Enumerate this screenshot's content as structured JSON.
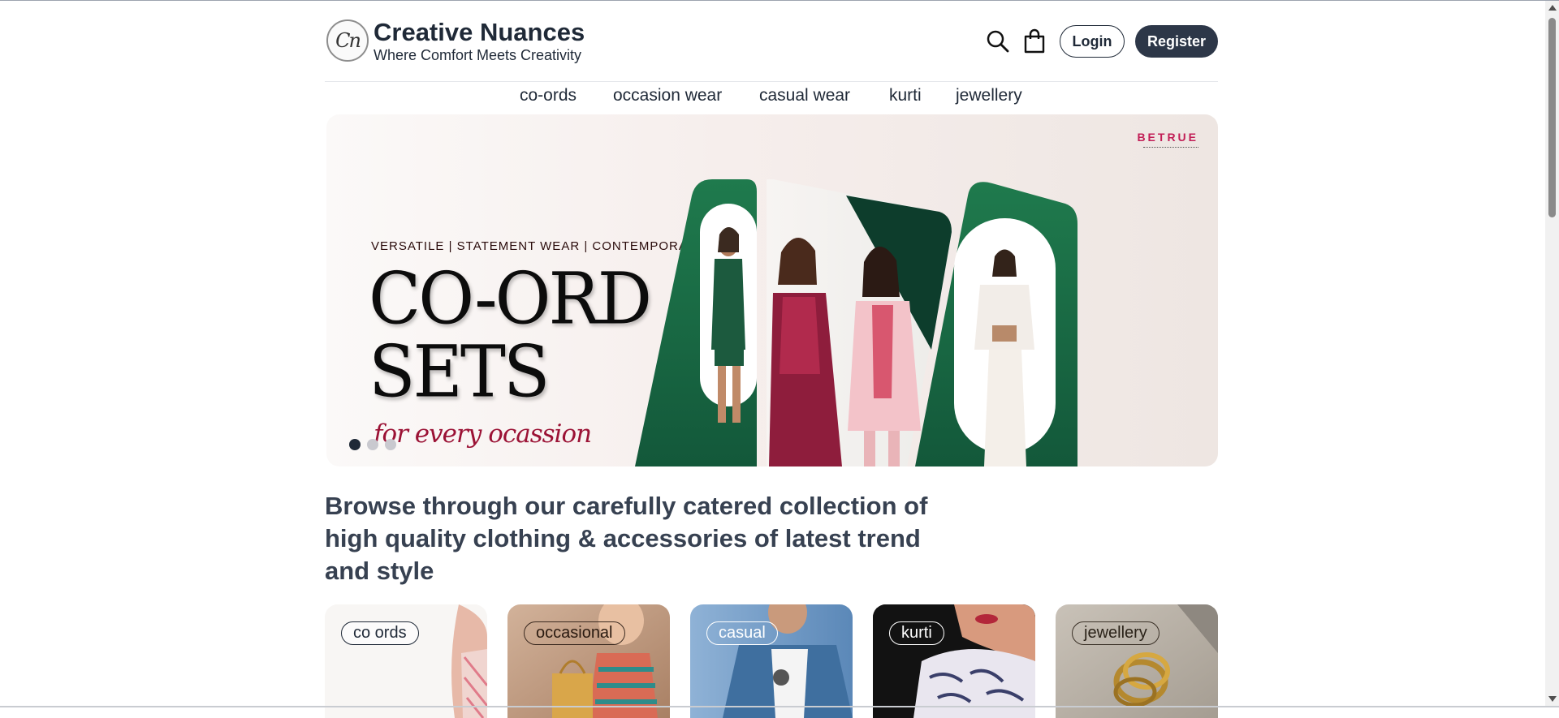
{
  "header": {
    "logo_text": "Cn",
    "brand_name": "Creative Nuances",
    "tagline": "Where Comfort Meets Creativity",
    "search_icon": "search-icon",
    "cart_icon": "shopping-bag-icon",
    "login_label": "Login",
    "register_label": "Register"
  },
  "nav": {
    "items": [
      {
        "label": "co-ords"
      },
      {
        "label": "occasion wear"
      },
      {
        "label": "casual wear"
      },
      {
        "label": "kurti"
      },
      {
        "label": "jewellery"
      }
    ]
  },
  "hero": {
    "brand": "BETRUE",
    "tags": "VERSATILE | STATEMENT WEAR | CONTEMPORARY",
    "title_line1": "CO-ORD",
    "title_line2": "SETS",
    "script": "for every ocassion",
    "slides_total": 3,
    "active_slide": 1
  },
  "browse": {
    "heading": "Browse through our carefully catered collection of high quality clothing & accessories of latest trend and style"
  },
  "categories": [
    {
      "label": "co ords"
    },
    {
      "label": "occasional"
    },
    {
      "label": "casual"
    },
    {
      "label": "kurti"
    },
    {
      "label": "jewellery"
    }
  ],
  "colors": {
    "primary_dark": "#2d3748",
    "text": "#1f2937",
    "heading": "#374151",
    "accent_green": "#1e6b45",
    "accent_maroon": "#9b1235"
  }
}
